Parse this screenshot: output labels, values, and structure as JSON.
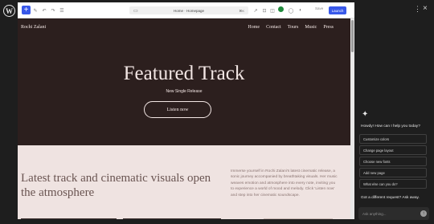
{
  "app": {
    "logo_glyph": "W"
  },
  "toolbar": {
    "add_glyph": "+",
    "tools": [
      "✎",
      "↶",
      "↷",
      "☰"
    ],
    "document_title": "Home · Homepage",
    "document_shortcut": "⌘K",
    "icons": [
      "↗",
      "⊡",
      "◫",
      "◯",
      "◐"
    ],
    "save_label": "Save",
    "launch_label": "Launch"
  },
  "site": {
    "title": "Rochi Zalani",
    "nav": [
      "Home",
      "Contact",
      "Tours",
      "Music",
      "Press"
    ],
    "hero_title": "Featured Track",
    "hero_subtitle": "New Single Release",
    "cta_label": "Listen now",
    "section_heading": "Latest track and cinematic visuals open the atmosphere",
    "section_paragraph": "Immerse yourself in Rochi Zalani's latest cinematic release, a sonic journey accompanied by breathtaking visuals. Her music weaves emotion and atmosphere into every note, inviting you to experience a world of mood and melody. Click 'Listen now' and step into her cinematic soundscape."
  },
  "assistant": {
    "greeting": "Howdy! How can I help you today?",
    "suggestions": [
      "Customize colors",
      "Change page layout",
      "Choose new fonts",
      "Add new page",
      "What else can you do?"
    ],
    "ask_prompt": "Got a different request? Ask away.",
    "input_placeholder": "Ask anything..."
  },
  "colors": {
    "accent": "#3858e9",
    "hero_bg": "#2c1f1e",
    "section_bg": "#efe3e1",
    "panel_bg": "#1e1e1e"
  }
}
